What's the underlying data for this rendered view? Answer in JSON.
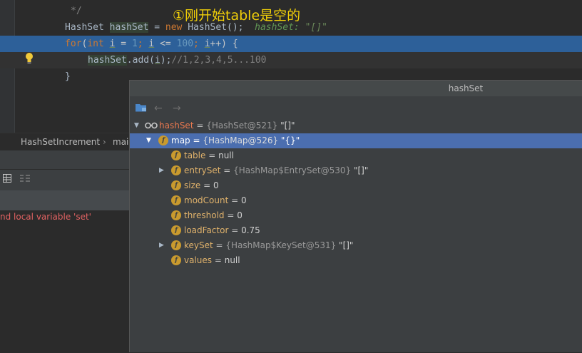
{
  "editor": {
    "comment_line": "*/",
    "hashset_decl": {
      "type": "HashSet",
      "name": "hashSet",
      "assign": " = ",
      "new_kw": "new",
      "ctor": " HashSet();",
      "inline_name": "hashSet:",
      "inline_value": "\"[]\""
    },
    "for_line": {
      "kw": "for",
      "open": "(",
      "int_kw": "int",
      "var": "i",
      "eq": " = ",
      "init": "1",
      "semi1": "; ",
      "var2": "i",
      "op": " <= ",
      "limit": "100",
      "semi2": "; ",
      "var3": "i",
      "inc": "++) {"
    },
    "add_line": {
      "obj": "hashSet",
      "call": ".add(",
      "arg": "i",
      "close": ");",
      "comment": "//1,2,3,4,5...100"
    },
    "close_brace": "}",
    "annotation": "①刚开始table是空的"
  },
  "left_panel": {
    "breadcrumb_class": "HashSetIncrement",
    "breadcrumb_sep": "›",
    "breadcrumb_method": "main",
    "error_text": "nd local variable 'set'"
  },
  "popup": {
    "title": "hashSet",
    "rows": [
      {
        "name": "hashSet",
        "eq": " = ",
        "ref": "{HashSet@521}",
        "value": " \"[]\""
      },
      {
        "name": "map",
        "eq": " = ",
        "ref": "{HashMap@526}",
        "value": " \"{}\""
      },
      {
        "name": "table",
        "eq": " = ",
        "ref": "",
        "value": "null"
      },
      {
        "name": "entrySet",
        "eq": " = ",
        "ref": "{HashMap$EntrySet@530}",
        "value": " \"[]\""
      },
      {
        "name": "size",
        "eq": " = ",
        "ref": "",
        "value": "0"
      },
      {
        "name": "modCount",
        "eq": " = ",
        "ref": "",
        "value": "0"
      },
      {
        "name": "threshold",
        "eq": " = ",
        "ref": "",
        "value": "0"
      },
      {
        "name": "loadFactor",
        "eq": " = ",
        "ref": "",
        "value": "0.75"
      },
      {
        "name": "keySet",
        "eq": " = ",
        "ref": "{HashMap$KeySet@531}",
        "value": " \"[]\""
      },
      {
        "name": "values",
        "eq": " = ",
        "ref": "",
        "value": "null"
      }
    ],
    "field_icon_letter": "f"
  },
  "icons": {
    "bulb": "lightbulb-icon",
    "folder": "folder-icon",
    "back": "←",
    "forward": "→",
    "expanded": "▼",
    "collapsed": "▶"
  },
  "colors": {
    "selection": "#4b6eaf",
    "current_line": "#2d6099",
    "annotation": "#f2d008",
    "field_icon": "#c99a2e",
    "error": "#e26262"
  }
}
